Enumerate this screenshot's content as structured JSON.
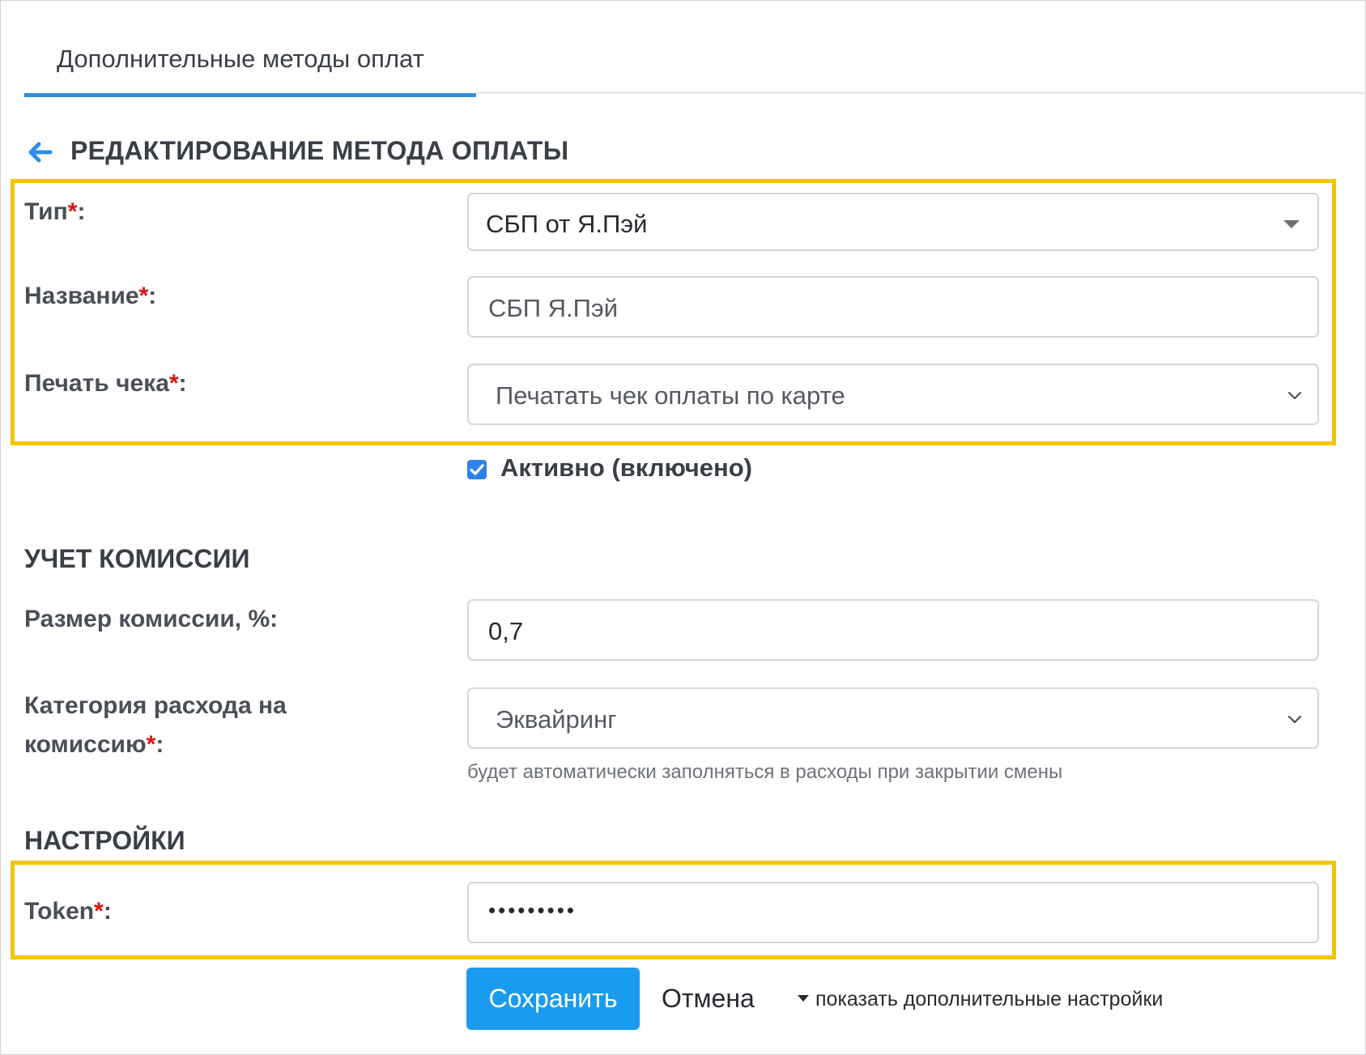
{
  "tabs": [
    {
      "label": "Дополнительные методы оплат",
      "active": true
    }
  ],
  "page_title": "РЕДАКТИРОВАНИЕ МЕТОДА ОПЛАТЫ",
  "form": {
    "type": {
      "label": "Тип",
      "required_mark": "*",
      "suffix": ":",
      "value": "СБП от Я.Пэй"
    },
    "name": {
      "label": "Название",
      "required_mark": "*",
      "suffix": ":",
      "value": "СБП Я.Пэй"
    },
    "receipt": {
      "label": "Печать чека",
      "required_mark": "*",
      "suffix": ":",
      "value": "Печатать чек оплаты по карте"
    },
    "active": {
      "label": "Активно (включено)",
      "checked": true
    }
  },
  "commission": {
    "heading": "УЧЕТ КОМИССИИ",
    "size": {
      "label": "Размер комиссии, %:",
      "value": "0,7"
    },
    "category": {
      "label_line1": "Категория расхода на",
      "label_line2": "комиссию",
      "required_mark": "*",
      "suffix": ":",
      "value": "Эквайринг",
      "hint": "будет автоматически заполняться в расходы при закрытии смены"
    }
  },
  "settings": {
    "heading": "НАСТРОЙКИ",
    "token": {
      "label": "Token",
      "required_mark": "*",
      "suffix": ":",
      "value": "•••••••••"
    }
  },
  "actions": {
    "save": "Сохранить",
    "cancel": "Отмена",
    "more": "показать дополнительные настройки"
  },
  "colors": {
    "accent": "#2e8fe6",
    "button": "#1a9bf0",
    "highlight": "#f5c400",
    "required": "#e01010"
  }
}
